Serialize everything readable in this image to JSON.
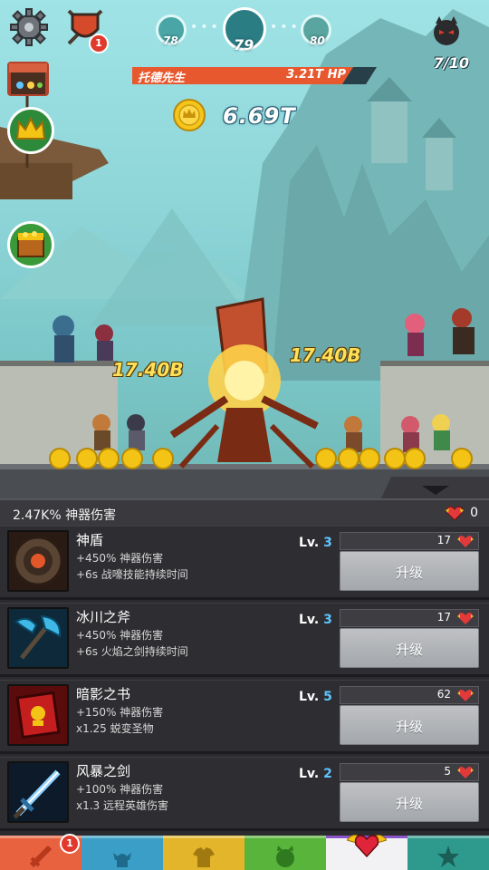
{
  "hud": {
    "stage_prev": "78",
    "stage_current": "79",
    "stage_next": "80",
    "wave": "7/10",
    "top_badge": "1",
    "icons": [
      "gear-icon",
      "shield-icon",
      "shop-icon",
      "crown-icon",
      "treasure-chest-icon",
      "devil-icon"
    ]
  },
  "boss": {
    "name": "托德先生",
    "hp": "3.21T HP"
  },
  "gold": {
    "amount": "6.69T"
  },
  "damage_popups": {
    "left": "17.40B",
    "right": "17.40B"
  },
  "panel": {
    "header_label": "2.47K% 神器伤害",
    "relic_count": "0"
  },
  "artifacts": [
    {
      "name": "神盾",
      "line1": "+450% 神器伤害",
      "line2": "+6s 战嚎技能持续时间",
      "level_label": "Lv.",
      "level": "3",
      "cost": "17",
      "button": "升级"
    },
    {
      "name": "冰川之斧",
      "line1": "+450% 神器伤害",
      "line2": "+6s 火焰之剑持续时间",
      "level_label": "Lv.",
      "level": "3",
      "cost": "17",
      "button": "升级"
    },
    {
      "name": "暗影之书",
      "line1": "+150% 神器伤害",
      "line2": "x1.25 蜕变圣物",
      "level_label": "Lv.",
      "level": "5",
      "cost": "62",
      "button": "升级"
    },
    {
      "name": "风暴之剑",
      "line1": "+100% 神器伤害",
      "line2": "x1.3 远程英雄伤害",
      "level_label": "Lv.",
      "level": "2",
      "cost": "5",
      "button": "升级"
    }
  ],
  "tabs": {
    "badge": "1",
    "items": [
      "sword-tab",
      "hero-tab",
      "equipment-tab",
      "pet-tab",
      "artifacts-tab",
      "star-tab"
    ]
  },
  "colors": {
    "tab_sword": "#e8623f",
    "tab_heroes": "#3a9ec6",
    "tab_equipment": "#e3b52a",
    "tab_pets": "#58b43a",
    "tab_artifacts": "#8a55c9",
    "tab_star": "#2e9a8e",
    "hp_bar": "#e8582e",
    "level_number": "#5fc4ff"
  }
}
